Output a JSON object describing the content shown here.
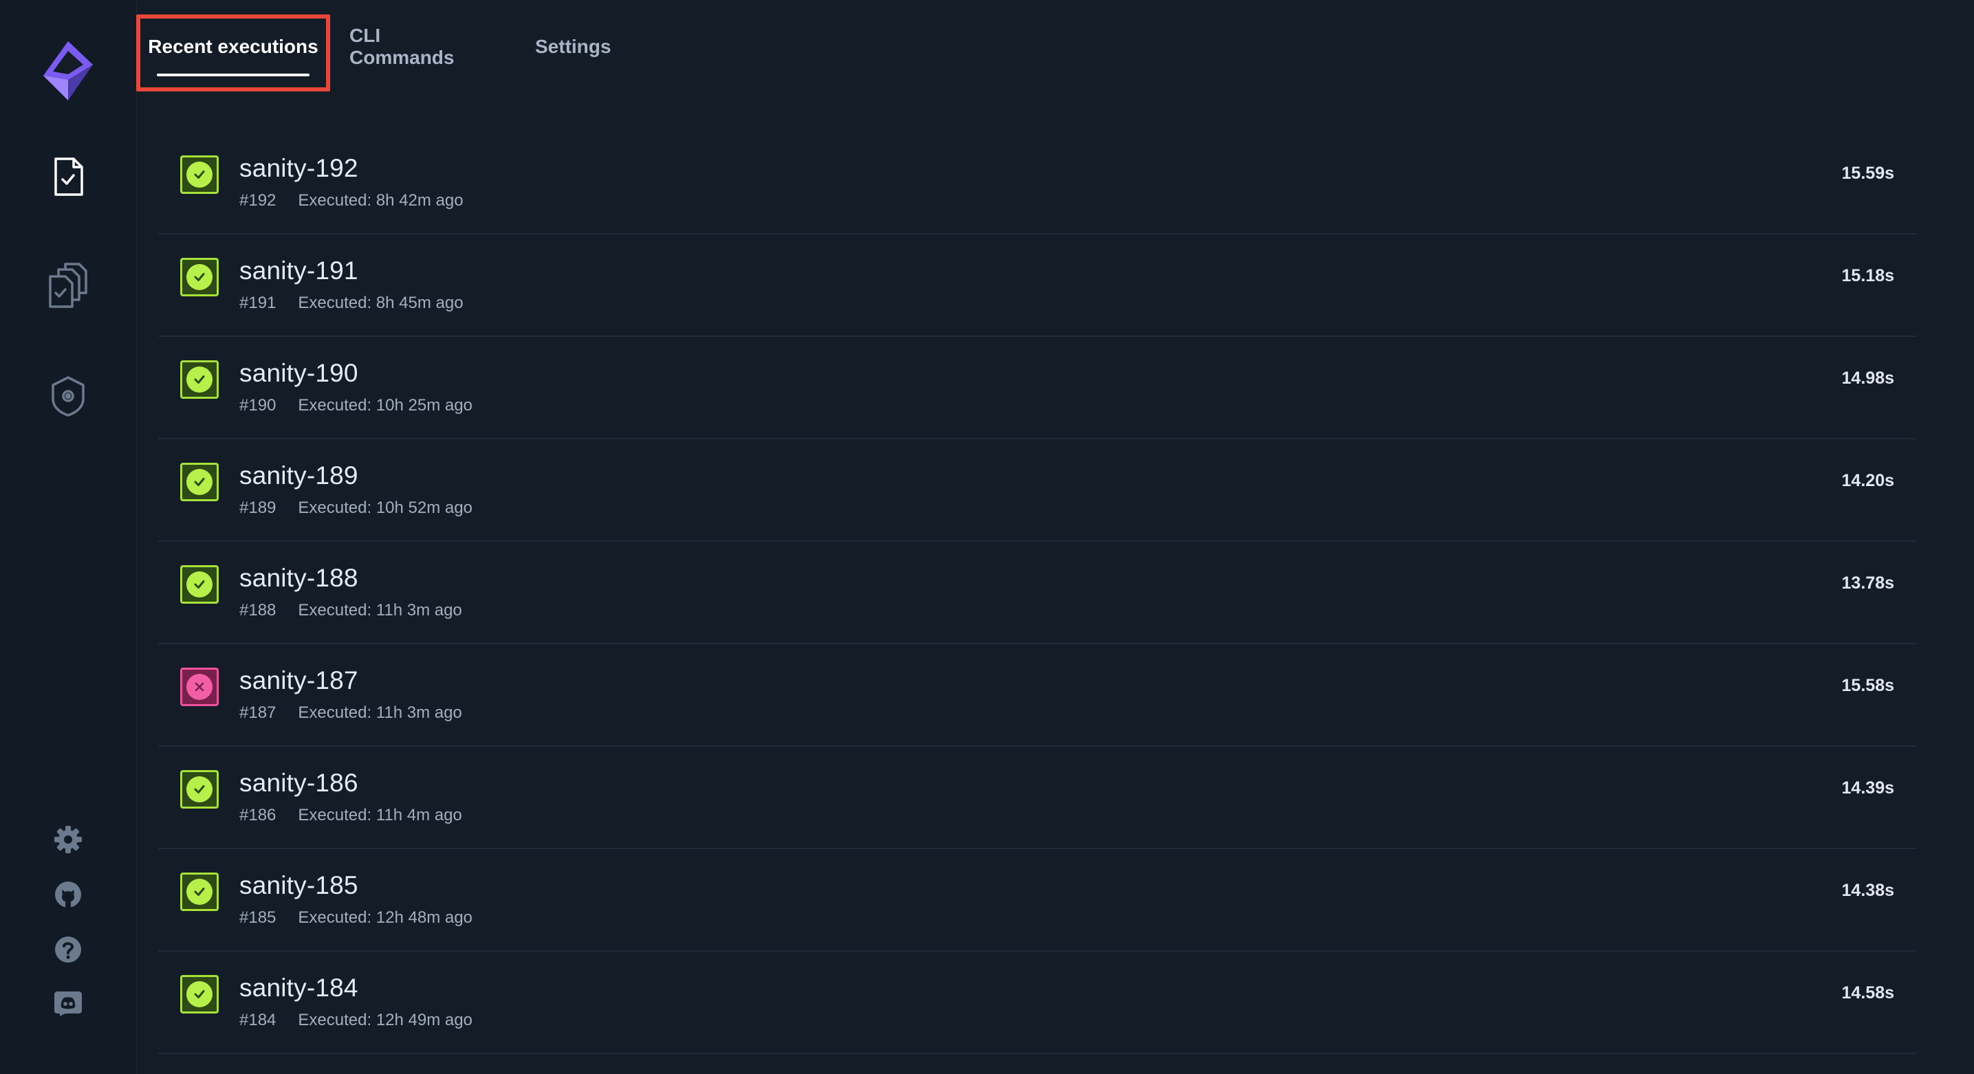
{
  "tabs": [
    {
      "label": "Recent executions",
      "active": true
    },
    {
      "label": "CLI Commands",
      "active": false
    },
    {
      "label": "Settings",
      "active": false
    }
  ],
  "sidebar": {
    "top_icons": [
      "logo-icon",
      "test-file-icon",
      "test-suites-icon",
      "shield-gear-icon"
    ],
    "bottom_icons": [
      "settings-gear-icon",
      "github-icon",
      "help-icon",
      "discord-icon"
    ]
  },
  "executions": [
    {
      "name": "sanity-192",
      "number": "#192",
      "executed": "Executed: 8h 42m ago",
      "duration": "15.59s",
      "status": "passed"
    },
    {
      "name": "sanity-191",
      "number": "#191",
      "executed": "Executed: 8h 45m ago",
      "duration": "15.18s",
      "status": "passed"
    },
    {
      "name": "sanity-190",
      "number": "#190",
      "executed": "Executed: 10h 25m ago",
      "duration": "14.98s",
      "status": "passed"
    },
    {
      "name": "sanity-189",
      "number": "#189",
      "executed": "Executed: 10h 52m ago",
      "duration": "14.20s",
      "status": "passed"
    },
    {
      "name": "sanity-188",
      "number": "#188",
      "executed": "Executed: 11h 3m ago",
      "duration": "13.78s",
      "status": "passed"
    },
    {
      "name": "sanity-187",
      "number": "#187",
      "executed": "Executed: 11h 3m ago",
      "duration": "15.58s",
      "status": "failed"
    },
    {
      "name": "sanity-186",
      "number": "#186",
      "executed": "Executed: 11h 4m ago",
      "duration": "14.39s",
      "status": "passed"
    },
    {
      "name": "sanity-185",
      "number": "#185",
      "executed": "Executed: 12h 48m ago",
      "duration": "14.38s",
      "status": "passed"
    },
    {
      "name": "sanity-184",
      "number": "#184",
      "executed": "Executed: 12h 49m ago",
      "duration": "14.58s",
      "status": "passed"
    }
  ],
  "colors": {
    "background": "#141c28",
    "passed": "#b7f04a",
    "failed": "#f35fa7",
    "highlight": "#e8473a",
    "logo": "#7b5cf0"
  }
}
